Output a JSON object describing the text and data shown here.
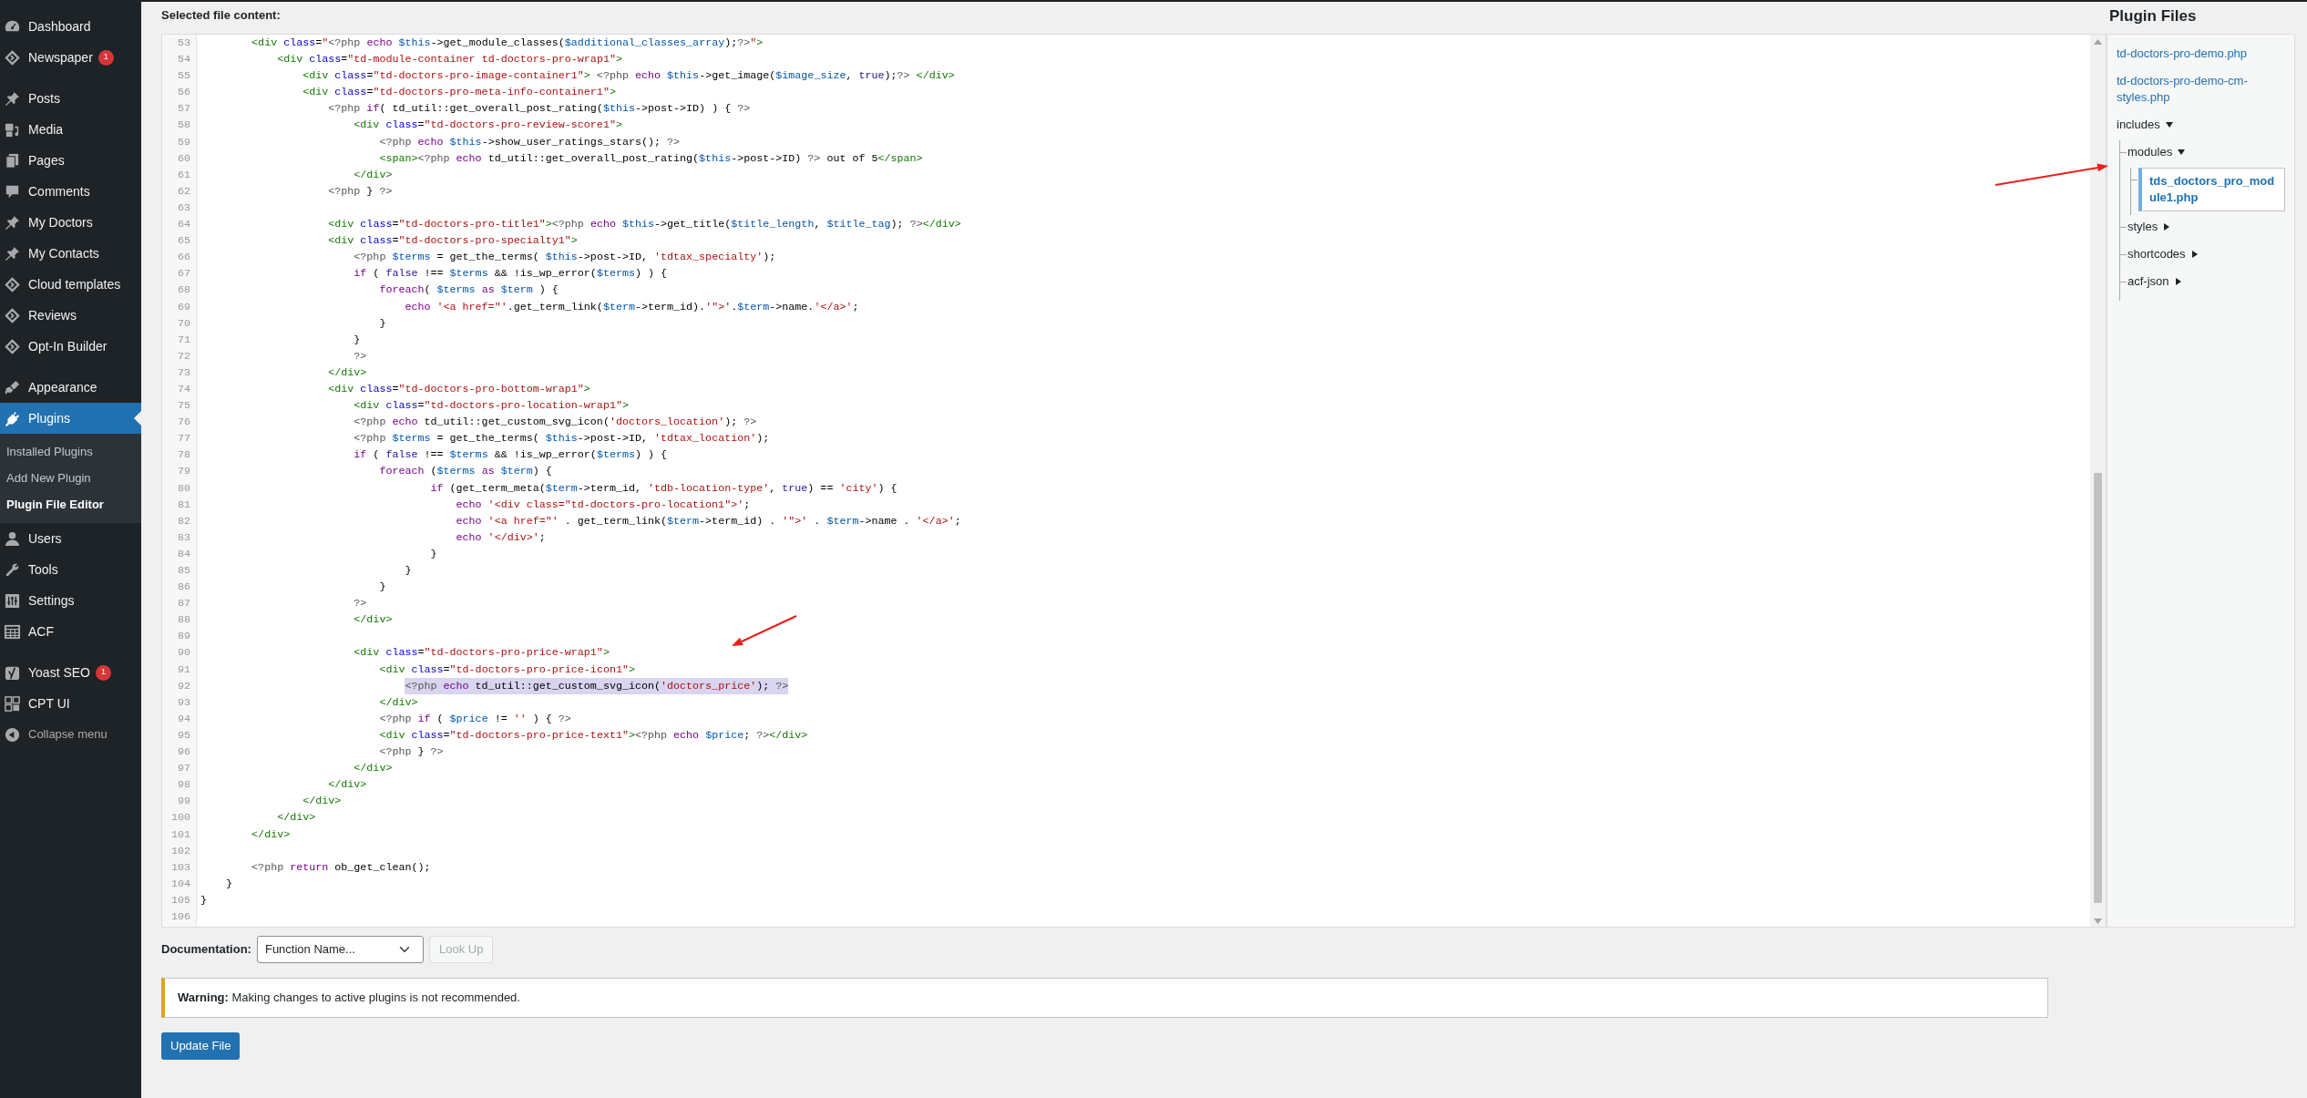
{
  "sidebar": {
    "groups": [
      [
        {
          "kind": "link",
          "label": "Dashboard",
          "selected": false
        },
        {
          "kind": "link",
          "label": "Newspaper",
          "badge": "1",
          "selected": false
        }
      ],
      [
        {
          "kind": "link",
          "label": "Posts",
          "selected": false
        },
        {
          "kind": "link",
          "label": "Media",
          "selected": false
        },
        {
          "kind": "link",
          "label": "Pages",
          "selected": false
        },
        {
          "kind": "link",
          "label": "Comments",
          "selected": false
        },
        {
          "kind": "link",
          "label": "My Doctors",
          "selected": false
        },
        {
          "kind": "link",
          "label": "My Contacts",
          "selected": false
        },
        {
          "kind": "link",
          "label": "Cloud templates",
          "selected": false
        },
        {
          "kind": "link",
          "label": "Reviews",
          "selected": false
        },
        {
          "kind": "link",
          "label": "Opt-In Builder",
          "selected": false
        }
      ],
      [
        {
          "kind": "link",
          "label": "Appearance",
          "selected": false
        },
        {
          "kind": "link",
          "label": "Plugins",
          "selected": true,
          "submenu": [
            {
              "label": "Installed Plugins",
              "selected": false
            },
            {
              "label": "Add New Plugin",
              "selected": false
            },
            {
              "label": "Plugin File Editor",
              "selected": true
            }
          ]
        },
        {
          "kind": "link",
          "label": "Users",
          "selected": false
        },
        {
          "kind": "link",
          "label": "Tools",
          "selected": false
        },
        {
          "kind": "link",
          "label": "Settings",
          "selected": false
        },
        {
          "kind": "link",
          "label": "ACF",
          "selected": false
        }
      ],
      [
        {
          "kind": "link",
          "label": "Yoast SEO",
          "badge": "1",
          "selected": false
        },
        {
          "kind": "link",
          "label": "CPT UI",
          "selected": false
        },
        {
          "kind": "collapse",
          "label": "Collapse menu",
          "selected": false
        }
      ]
    ]
  },
  "editor": {
    "label": "Selected file content:",
    "lines": [
      {
        "number": "53",
        "selected": false,
        "segments": [
          {
            "kind": "tag",
            "text": "\t\t<div"
          },
          {
            "kind": "attr",
            "text": " class"
          },
          {
            "kind": "plain",
            "text": "="
          },
          {
            "kind": "str",
            "text": "\""
          },
          {
            "kind": "meta",
            "text": "<?php"
          },
          {
            "kind": "kw",
            "text": " echo"
          },
          {
            "kind": "var",
            "text": " $this"
          },
          {
            "kind": "plain",
            "text": "->get_module_classes("
          },
          {
            "kind": "var",
            "text": "$additional_classes_array"
          },
          {
            "kind": "plain",
            "text": ");"
          },
          {
            "kind": "meta",
            "text": "?>"
          },
          {
            "kind": "str",
            "text": "\""
          },
          {
            "kind": "tag",
            "text": ">"
          }
        ]
      },
      {
        "number": "54",
        "selected": false,
        "segments": [
          {
            "kind": "tag",
            "text": "\t\t\t<div"
          },
          {
            "kind": "attr",
            "text": " class"
          },
          {
            "kind": "plain",
            "text": "="
          },
          {
            "kind": "str",
            "text": "\"td-module-container td-doctors-pro-wrap1\""
          },
          {
            "kind": "tag",
            "text": ">"
          }
        ]
      },
      {
        "number": "55",
        "selected": false,
        "segments": [
          {
            "kind": "tag",
            "text": "\t\t\t\t<div"
          },
          {
            "kind": "attr",
            "text": " class"
          },
          {
            "kind": "plain",
            "text": "="
          },
          {
            "kind": "str",
            "text": "\"td-doctors-pro-image-container1\""
          },
          {
            "kind": "tag",
            "text": ">"
          },
          {
            "kind": "meta",
            "text": " <?php"
          },
          {
            "kind": "kw",
            "text": " echo"
          },
          {
            "kind": "var",
            "text": " $this"
          },
          {
            "kind": "plain",
            "text": "->get_image("
          },
          {
            "kind": "var",
            "text": "$image_size"
          },
          {
            "kind": "plain",
            "text": ", "
          },
          {
            "kind": "atom",
            "text": "true"
          },
          {
            "kind": "plain",
            "text": ");"
          },
          {
            "kind": "meta",
            "text": "?>"
          },
          {
            "kind": "tag",
            "text": " </div>"
          }
        ]
      },
      {
        "number": "56",
        "selected": false,
        "segments": [
          {
            "kind": "tag",
            "text": "\t\t\t\t<div"
          },
          {
            "kind": "attr",
            "text": " class"
          },
          {
            "kind": "plain",
            "text": "="
          },
          {
            "kind": "str",
            "text": "\"td-doctors-pro-meta-info-container1\""
          },
          {
            "kind": "tag",
            "text": ">"
          }
        ]
      },
      {
        "number": "57",
        "selected": false,
        "segments": [
          {
            "kind": "meta",
            "text": "\t\t\t\t\t<?php"
          },
          {
            "kind": "kw",
            "text": " if"
          },
          {
            "kind": "plain",
            "text": "( td_util::get_overall_post_rating("
          },
          {
            "kind": "var",
            "text": "$this"
          },
          {
            "kind": "plain",
            "text": "->post->ID) ) { "
          },
          {
            "kind": "meta",
            "text": "?>"
          }
        ]
      },
      {
        "number": "58",
        "selected": false,
        "segments": [
          {
            "kind": "tag",
            "text": "\t\t\t\t\t\t<div"
          },
          {
            "kind": "attr",
            "text": " class"
          },
          {
            "kind": "plain",
            "text": "="
          },
          {
            "kind": "str",
            "text": "\"td-doctors-pro-review-score1\""
          },
          {
            "kind": "tag",
            "text": ">"
          }
        ]
      },
      {
        "number": "59",
        "selected": false,
        "segments": [
          {
            "kind": "meta",
            "text": "\t\t\t\t\t\t\t<?php"
          },
          {
            "kind": "kw",
            "text": " echo"
          },
          {
            "kind": "var",
            "text": " $this"
          },
          {
            "kind": "plain",
            "text": "->show_user_ratings_stars(); "
          },
          {
            "kind": "meta",
            "text": "?>"
          }
        ]
      },
      {
        "number": "60",
        "selected": false,
        "segments": [
          {
            "kind": "tag",
            "text": "\t\t\t\t\t\t\t<span>"
          },
          {
            "kind": "meta",
            "text": "<?php"
          },
          {
            "kind": "kw",
            "text": " echo"
          },
          {
            "kind": "plain",
            "text": " td_util::get_overall_post_rating("
          },
          {
            "kind": "var",
            "text": "$this"
          },
          {
            "kind": "plain",
            "text": "->post->ID) "
          },
          {
            "kind": "meta",
            "text": "?>"
          },
          {
            "kind": "plain",
            "text": " out of 5"
          },
          {
            "kind": "tag",
            "text": "</span>"
          }
        ]
      },
      {
        "number": "61",
        "selected": false,
        "segments": [
          {
            "kind": "tag",
            "text": "\t\t\t\t\t\t</div>"
          }
        ]
      },
      {
        "number": "62",
        "selected": false,
        "segments": [
          {
            "kind": "meta",
            "text": "\t\t\t\t\t<?php"
          },
          {
            "kind": "plain",
            "text": " } "
          },
          {
            "kind": "meta",
            "text": "?>"
          }
        ]
      },
      {
        "number": "63"
      },
      {
        "number": "64",
        "selected": false,
        "segments": [
          {
            "kind": "tag",
            "text": "\t\t\t\t\t<div"
          },
          {
            "kind": "attr",
            "text": " class"
          },
          {
            "kind": "plain",
            "text": "="
          },
          {
            "kind": "str",
            "text": "\"td-doctors-pro-title1\""
          },
          {
            "kind": "tag",
            "text": ">"
          },
          {
            "kind": "meta",
            "text": "<?php"
          },
          {
            "kind": "kw",
            "text": " echo"
          },
          {
            "kind": "var",
            "text": " $this"
          },
          {
            "kind": "plain",
            "text": "->get_title("
          },
          {
            "kind": "var",
            "text": "$title_length"
          },
          {
            "kind": "plain",
            "text": ", "
          },
          {
            "kind": "var",
            "text": "$title_tag"
          },
          {
            "kind": "plain",
            "text": "); "
          },
          {
            "kind": "meta",
            "text": "?>"
          },
          {
            "kind": "tag",
            "text": "</div>"
          }
        ]
      },
      {
        "number": "65",
        "selected": false,
        "segments": [
          {
            "kind": "tag",
            "text": "\t\t\t\t\t<div"
          },
          {
            "kind": "attr",
            "text": " class"
          },
          {
            "kind": "plain",
            "text": "="
          },
          {
            "kind": "str",
            "text": "\"td-doctors-pro-specialty1\""
          },
          {
            "kind": "tag",
            "text": ">"
          }
        ]
      },
      {
        "number": "66",
        "selected": false,
        "segments": [
          {
            "kind": "meta",
            "text": "\t\t\t\t\t\t<?php"
          },
          {
            "kind": "var",
            "text": " $terms"
          },
          {
            "kind": "plain",
            "text": " = get_the_terms( "
          },
          {
            "kind": "var",
            "text": "$this"
          },
          {
            "kind": "plain",
            "text": "->post->ID, "
          },
          {
            "kind": "str",
            "text": "'tdtax_specialty'"
          },
          {
            "kind": "plain",
            "text": ");"
          }
        ]
      },
      {
        "number": "67",
        "selected": false,
        "segments": [
          {
            "kind": "kw",
            "text": "\t\t\t\t\t\tif"
          },
          {
            "kind": "plain",
            "text": " ( "
          },
          {
            "kind": "atom",
            "text": "false"
          },
          {
            "kind": "plain",
            "text": " !== "
          },
          {
            "kind": "var",
            "text": "$terms"
          },
          {
            "kind": "plain",
            "text": " && !is_wp_error("
          },
          {
            "kind": "var",
            "text": "$terms"
          },
          {
            "kind": "plain",
            "text": ") ) {"
          }
        ]
      },
      {
        "number": "68",
        "selected": false,
        "segments": [
          {
            "kind": "kw",
            "text": "\t\t\t\t\t\t\tforeach"
          },
          {
            "kind": "plain",
            "text": "( "
          },
          {
            "kind": "var",
            "text": "$terms"
          },
          {
            "kind": "kw",
            "text": " as"
          },
          {
            "kind": "var",
            "text": " $term"
          },
          {
            "kind": "plain",
            "text": " ) {"
          }
        ]
      },
      {
        "number": "69",
        "selected": false,
        "segments": [
          {
            "kind": "kw",
            "text": "\t\t\t\t\t\t\t\techo"
          },
          {
            "kind": "str",
            "text": " '<a href=\"'"
          },
          {
            "kind": "plain",
            "text": ".get_term_link("
          },
          {
            "kind": "var",
            "text": "$term"
          },
          {
            "kind": "plain",
            "text": "->term_id)."
          },
          {
            "kind": "str",
            "text": "'\">'"
          },
          {
            "kind": "plain",
            "text": "."
          },
          {
            "kind": "var",
            "text": "$term"
          },
          {
            "kind": "plain",
            "text": "->name."
          },
          {
            "kind": "str",
            "text": "'</a>'"
          },
          {
            "kind": "plain",
            "text": ";"
          }
        ]
      },
      {
        "number": "70",
        "selected": false,
        "segments": [
          {
            "kind": "plain",
            "text": "\t\t\t\t\t\t\t}"
          }
        ]
      },
      {
        "number": "71",
        "selected": false,
        "segments": [
          {
            "kind": "plain",
            "text": "\t\t\t\t\t\t}"
          }
        ]
      },
      {
        "number": "72",
        "selected": false,
        "segments": [
          {
            "kind": "meta",
            "text": "\t\t\t\t\t\t?>"
          }
        ]
      },
      {
        "number": "73",
        "selected": false,
        "segments": [
          {
            "kind": "tag",
            "text": "\t\t\t\t\t</div>"
          }
        ]
      },
      {
        "number": "74",
        "selected": false,
        "segments": [
          {
            "kind": "tag",
            "text": "\t\t\t\t\t<div"
          },
          {
            "kind": "attr",
            "text": " class"
          },
          {
            "kind": "plain",
            "text": "="
          },
          {
            "kind": "str",
            "text": "\"td-doctors-pro-bottom-wrap1\""
          },
          {
            "kind": "tag",
            "text": ">"
          }
        ]
      },
      {
        "number": "75",
        "selected": false,
        "segments": [
          {
            "kind": "tag",
            "text": "\t\t\t\t\t\t<div"
          },
          {
            "kind": "attr",
            "text": " class"
          },
          {
            "kind": "plain",
            "text": "="
          },
          {
            "kind": "str",
            "text": "\"td-doctors-pro-location-wrap1\""
          },
          {
            "kind": "tag",
            "text": ">"
          }
        ]
      },
      {
        "number": "76",
        "selected": false,
        "segments": [
          {
            "kind": "meta",
            "text": "\t\t\t\t\t\t<?php"
          },
          {
            "kind": "kw",
            "text": " echo"
          },
          {
            "kind": "plain",
            "text": " td_util::get_custom_svg_icon("
          },
          {
            "kind": "str",
            "text": "'doctors_location'"
          },
          {
            "kind": "plain",
            "text": "); "
          },
          {
            "kind": "meta",
            "text": "?>"
          }
        ]
      },
      {
        "number": "77",
        "selected": false,
        "segments": [
          {
            "kind": "meta",
            "text": "\t\t\t\t\t\t<?php"
          },
          {
            "kind": "var",
            "text": " $terms"
          },
          {
            "kind": "plain",
            "text": " = get_the_terms( "
          },
          {
            "kind": "var",
            "text": "$this"
          },
          {
            "kind": "plain",
            "text": "->post->ID, "
          },
          {
            "kind": "str",
            "text": "'tdtax_location'"
          },
          {
            "kind": "plain",
            "text": ");"
          }
        ]
      },
      {
        "number": "78",
        "selected": false,
        "segments": [
          {
            "kind": "kw",
            "text": "\t\t\t\t\t\tif"
          },
          {
            "kind": "plain",
            "text": " ( "
          },
          {
            "kind": "atom",
            "text": "false"
          },
          {
            "kind": "plain",
            "text": " !== "
          },
          {
            "kind": "var",
            "text": "$terms"
          },
          {
            "kind": "plain",
            "text": " && !is_wp_error("
          },
          {
            "kind": "var",
            "text": "$terms"
          },
          {
            "kind": "plain",
            "text": ") ) {"
          }
        ]
      },
      {
        "number": "79",
        "selected": false,
        "segments": [
          {
            "kind": "kw",
            "text": "\t\t\t\t\t\t\tforeach"
          },
          {
            "kind": "plain",
            "text": " ("
          },
          {
            "kind": "var",
            "text": "$terms"
          },
          {
            "kind": "kw",
            "text": " as"
          },
          {
            "kind": "var",
            "text": " $term"
          },
          {
            "kind": "plain",
            "text": ") {"
          }
        ]
      },
      {
        "number": "80",
        "selected": false,
        "segments": [
          {
            "kind": "kw",
            "text": "\t\t\t\t\t\t\t\t\tif"
          },
          {
            "kind": "plain",
            "text": " (get_term_meta("
          },
          {
            "kind": "var",
            "text": "$term"
          },
          {
            "kind": "plain",
            "text": "->term_id, "
          },
          {
            "kind": "str",
            "text": "'tdb-location-type'"
          },
          {
            "kind": "plain",
            "text": ", "
          },
          {
            "kind": "atom",
            "text": "true"
          },
          {
            "kind": "plain",
            "text": ") == "
          },
          {
            "kind": "str",
            "text": "'city'"
          },
          {
            "kind": "plain",
            "text": ") {"
          }
        ]
      },
      {
        "number": "81",
        "selected": false,
        "segments": [
          {
            "kind": "kw",
            "text": "\t\t\t\t\t\t\t\t\t\techo"
          },
          {
            "kind": "str",
            "text": " '<div class=\"td-doctors-pro-location1\">'"
          },
          {
            "kind": "plain",
            "text": ";"
          }
        ]
      },
      {
        "number": "82",
        "selected": false,
        "segments": [
          {
            "kind": "kw",
            "text": "\t\t\t\t\t\t\t\t\t\techo"
          },
          {
            "kind": "str",
            "text": " '<a href=\"'"
          },
          {
            "kind": "plain",
            "text": " . get_term_link("
          },
          {
            "kind": "var",
            "text": "$term"
          },
          {
            "kind": "plain",
            "text": "->term_id) . "
          },
          {
            "kind": "str",
            "text": "'\">'"
          },
          {
            "kind": "plain",
            "text": " . "
          },
          {
            "kind": "var",
            "text": "$term"
          },
          {
            "kind": "plain",
            "text": "->name . "
          },
          {
            "kind": "str",
            "text": "'</a>'"
          },
          {
            "kind": "plain",
            "text": ";"
          }
        ]
      },
      {
        "number": "83",
        "selected": false,
        "segments": [
          {
            "kind": "kw",
            "text": "\t\t\t\t\t\t\t\t\t\techo"
          },
          {
            "kind": "str",
            "text": " '</div>'"
          },
          {
            "kind": "plain",
            "text": ";"
          }
        ]
      },
      {
        "number": "84",
        "selected": false,
        "segments": [
          {
            "kind": "plain",
            "text": "\t\t\t\t\t\t\t\t\t}"
          }
        ]
      },
      {
        "number": "85",
        "selected": false,
        "segments": [
          {
            "kind": "plain",
            "text": "\t\t\t\t\t\t\t\t}"
          }
        ]
      },
      {
        "number": "86",
        "selected": false,
        "segments": [
          {
            "kind": "plain",
            "text": "\t\t\t\t\t\t\t}"
          }
        ]
      },
      {
        "number": "87",
        "selected": false,
        "segments": [
          {
            "kind": "meta",
            "text": "\t\t\t\t\t\t?>"
          }
        ]
      },
      {
        "number": "88",
        "selected": false,
        "segments": [
          {
            "kind": "tag",
            "text": "\t\t\t\t\t\t</div>"
          }
        ]
      },
      {
        "number": "89"
      },
      {
        "number": "90",
        "selected": false,
        "segments": [
          {
            "kind": "tag",
            "text": "\t\t\t\t\t\t<div"
          },
          {
            "kind": "attr",
            "text": " class"
          },
          {
            "kind": "plain",
            "text": "="
          },
          {
            "kind": "str",
            "text": "\"td-doctors-pro-price-wrap1\""
          },
          {
            "kind": "tag",
            "text": ">"
          }
        ]
      },
      {
        "number": "91",
        "selected": false,
        "segments": [
          {
            "kind": "tag",
            "text": "\t\t\t\t\t\t\t<div"
          },
          {
            "kind": "attr",
            "text": " class"
          },
          {
            "kind": "plain",
            "text": "="
          },
          {
            "kind": "str",
            "text": "\"td-doctors-pro-price-icon1\""
          },
          {
            "kind": "tag",
            "text": ">"
          }
        ]
      },
      {
        "number": "92",
        "selected": true,
        "segments": [
          {
            "kind": "meta",
            "text": "\t\t\t\t\t\t\t\t<?php"
          },
          {
            "kind": "kw",
            "text": " echo"
          },
          {
            "kind": "plain",
            "text": " td_util::get_custom_svg_icon("
          },
          {
            "kind": "str",
            "text": "'doctors_price'"
          },
          {
            "kind": "plain",
            "text": "); "
          },
          {
            "kind": "meta",
            "text": "?>"
          }
        ]
      },
      {
        "number": "93",
        "selected": false,
        "segments": [
          {
            "kind": "tag",
            "text": "\t\t\t\t\t\t\t</div>"
          }
        ]
      },
      {
        "number": "94",
        "selected": false,
        "segments": [
          {
            "kind": "meta",
            "text": "\t\t\t\t\t\t\t<?php"
          },
          {
            "kind": "kw",
            "text": " if"
          },
          {
            "kind": "plain",
            "text": " ( "
          },
          {
            "kind": "var",
            "text": "$price"
          },
          {
            "kind": "plain",
            "text": " != "
          },
          {
            "kind": "str",
            "text": "''"
          },
          {
            "kind": "plain",
            "text": " ) { "
          },
          {
            "kind": "meta",
            "text": "?>"
          }
        ]
      },
      {
        "number": "95",
        "selected": false,
        "segments": [
          {
            "kind": "tag",
            "text": "\t\t\t\t\t\t\t<div"
          },
          {
            "kind": "attr",
            "text": " class"
          },
          {
            "kind": "plain",
            "text": "="
          },
          {
            "kind": "str",
            "text": "\"td-doctors-pro-price-text1\""
          },
          {
            "kind": "tag",
            "text": ">"
          },
          {
            "kind": "meta",
            "text": "<?php"
          },
          {
            "kind": "kw",
            "text": " echo"
          },
          {
            "kind": "var",
            "text": " $price"
          },
          {
            "kind": "plain",
            "text": "; "
          },
          {
            "kind": "meta",
            "text": "?>"
          },
          {
            "kind": "tag",
            "text": "</div>"
          }
        ]
      },
      {
        "number": "96",
        "selected": false,
        "segments": [
          {
            "kind": "meta",
            "text": "\t\t\t\t\t\t\t<?php"
          },
          {
            "kind": "plain",
            "text": " } "
          },
          {
            "kind": "meta",
            "text": "?>"
          }
        ]
      },
      {
        "number": "97",
        "selected": false,
        "segments": [
          {
            "kind": "tag",
            "text": "\t\t\t\t\t\t</div>"
          }
        ]
      },
      {
        "number": "98",
        "selected": false,
        "segments": [
          {
            "kind": "tag",
            "text": "\t\t\t\t\t</div>"
          }
        ]
      },
      {
        "number": "99",
        "selected": false,
        "segments": [
          {
            "kind": "tag",
            "text": "\t\t\t\t</div>"
          }
        ]
      },
      {
        "number": "100",
        "selected": false,
        "segments": [
          {
            "kind": "tag",
            "text": "\t\t\t</div>"
          }
        ]
      },
      {
        "number": "101",
        "selected": false,
        "segments": [
          {
            "kind": "tag",
            "text": "\t\t</div>"
          }
        ]
      },
      {
        "number": "102"
      },
      {
        "number": "103",
        "selected": false,
        "segments": [
          {
            "kind": "meta",
            "text": "\t\t<?php"
          },
          {
            "kind": "kw",
            "text": " return"
          },
          {
            "kind": "plain",
            "text": " ob_get_clean();"
          }
        ]
      },
      {
        "number": "104",
        "selected": false,
        "segments": [
          {
            "kind": "plain",
            "text": "\t}"
          }
        ]
      },
      {
        "number": "105",
        "selected": false,
        "segments": [
          {
            "kind": "plain",
            "text": "}"
          }
        ]
      },
      {
        "number": "106"
      }
    ]
  },
  "plugin_files": {
    "title": "Plugin Files",
    "items": [
      {
        "kind": "file",
        "name": "td-doctors-pro-demo.php",
        "selected": false
      },
      {
        "kind": "file",
        "name": "td-doctors-pro-demo-cm-styles.php",
        "selected": false
      },
      {
        "kind": "folder",
        "name": "includes",
        "expanded": true,
        "children": [
          {
            "kind": "folder",
            "name": "modules",
            "expanded": true,
            "children": [
              {
                "kind": "file",
                "name": "tds_doctors_pro_module1.php",
                "selected": true
              }
            ]
          },
          {
            "kind": "folder",
            "name": "styles",
            "expanded": false
          },
          {
            "kind": "folder",
            "name": "shortcodes",
            "expanded": false
          },
          {
            "kind": "folder",
            "name": "acf-json",
            "expanded": false
          }
        ]
      }
    ]
  },
  "documentation": {
    "label": "Documentation:",
    "select_value": "Function Name...",
    "button": {
      "label": "Look Up",
      "disabled": true
    }
  },
  "notice": {
    "text": "**Warning:** Making changes to active plugins is not recommended."
  },
  "submit": {
    "label": "Update File"
  }
}
